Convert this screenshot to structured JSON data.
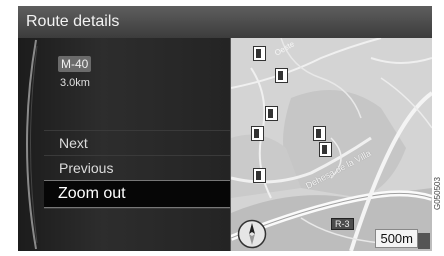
{
  "header": {
    "title": "Route details"
  },
  "route": {
    "road": "M-40",
    "distance": "3.0km"
  },
  "menu": {
    "items": [
      {
        "label": "Next",
        "selected": false
      },
      {
        "label": "Previous",
        "selected": false
      },
      {
        "label": "Zoom out",
        "selected": true
      }
    ]
  },
  "map": {
    "scale": "500m",
    "road_label": "R-3",
    "street_label": "Dehesa de la Villa",
    "street_label_2": "Oeste"
  },
  "image_code": "G050503",
  "colors": {
    "background": "#141414",
    "selection": "#060606",
    "map": "#d4d4d4"
  },
  "icons": [
    "compass-icon",
    "poi-icon",
    "road-shield-icon"
  ]
}
